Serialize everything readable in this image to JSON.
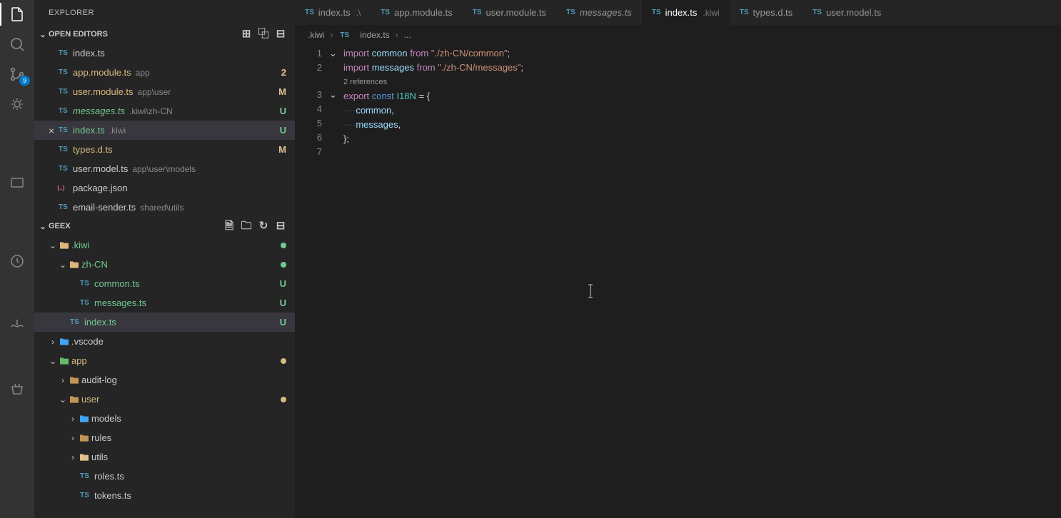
{
  "sidebar": {
    "title": "EXPLORER",
    "openEditors": {
      "label": "OPEN EDITORS",
      "items": [
        {
          "file": "index.ts",
          "hint": "",
          "status": "",
          "close": false,
          "italic": false
        },
        {
          "file": "app.module.ts",
          "hint": "app",
          "status": "2",
          "close": false,
          "italic": false,
          "color": "yellow"
        },
        {
          "file": "user.module.ts",
          "hint": "app\\user",
          "status": "M",
          "close": false,
          "italic": false,
          "color": "yellow"
        },
        {
          "file": "messages.ts",
          "hint": ".kiwi\\zh-CN",
          "status": "U",
          "close": false,
          "italic": true,
          "color": "green"
        },
        {
          "file": "index.ts",
          "hint": ".kiwi",
          "status": "U",
          "close": true,
          "italic": false,
          "color": "green",
          "selected": true
        },
        {
          "file": "types.d.ts",
          "hint": "",
          "status": "M",
          "close": false,
          "italic": false,
          "color": "yellow"
        },
        {
          "file": "user.model.ts",
          "hint": "app\\user\\models",
          "status": "",
          "close": false,
          "italic": false
        },
        {
          "file": "package.json",
          "hint": "",
          "status": "",
          "close": false,
          "italic": false,
          "iconType": "json"
        },
        {
          "file": "email-sender.ts",
          "hint": "shared\\utils",
          "status": "",
          "close": false,
          "italic": false
        }
      ]
    },
    "project": {
      "label": "GEEX",
      "tree": [
        {
          "depth": 0,
          "chev": "down",
          "icon": "folder-open",
          "name": ".kiwi",
          "dot": "green",
          "color": "green"
        },
        {
          "depth": 1,
          "chev": "down",
          "icon": "folder-open",
          "name": "zh-CN",
          "dot": "green",
          "color": "green"
        },
        {
          "depth": 2,
          "chev": "",
          "icon": "ts",
          "name": "common.ts",
          "status": "U",
          "color": "green"
        },
        {
          "depth": 2,
          "chev": "",
          "icon": "ts",
          "name": "messages.ts",
          "status": "U",
          "color": "green"
        },
        {
          "depth": 1,
          "chev": "",
          "icon": "ts",
          "name": "index.ts",
          "status": "U",
          "color": "green",
          "selected": true
        },
        {
          "depth": 0,
          "chev": "right",
          "icon": "folder-special",
          "name": ".vscode"
        },
        {
          "depth": 0,
          "chev": "down",
          "icon": "folder-app",
          "name": "app",
          "dot": "yellow",
          "color": "yellow"
        },
        {
          "depth": 1,
          "chev": "right",
          "icon": "folder",
          "name": "audit-log"
        },
        {
          "depth": 1,
          "chev": "down",
          "icon": "folder",
          "name": "user",
          "dot": "yellow",
          "color": "yellow"
        },
        {
          "depth": 2,
          "chev": "right",
          "icon": "folder-models",
          "name": "models"
        },
        {
          "depth": 2,
          "chev": "right",
          "icon": "folder",
          "name": "rules"
        },
        {
          "depth": 2,
          "chev": "right",
          "icon": "folder-utils",
          "name": "utils"
        },
        {
          "depth": 2,
          "chev": "",
          "icon": "ts",
          "name": "roles.ts"
        },
        {
          "depth": 2,
          "chev": "",
          "icon": "ts",
          "name": "tokens.ts"
        }
      ]
    }
  },
  "activityBadge": "9",
  "tabs": [
    {
      "label": "index.ts",
      "hint": ".\\",
      "active": false
    },
    {
      "label": "app.module.ts",
      "hint": "",
      "active": false
    },
    {
      "label": "user.module.ts",
      "hint": "",
      "active": false
    },
    {
      "label": "messages.ts",
      "hint": "",
      "active": false,
      "italic": true
    },
    {
      "label": "index.ts",
      "hint": ".kiwi",
      "active": true
    },
    {
      "label": "types.d.ts",
      "hint": "",
      "active": false
    },
    {
      "label": "user.model.ts",
      "hint": "",
      "active": false
    }
  ],
  "breadcrumb": {
    "p1": ".kiwi",
    "p2": "index.ts",
    "p3": "..."
  },
  "code": {
    "codelens": "2 references",
    "lines": [
      "1",
      "2",
      "3",
      "4",
      "5",
      "6",
      "7"
    ],
    "l1": {
      "kw": "import",
      "v": "common",
      "kw2": "from",
      "s": "\"./zh-CN/common\""
    },
    "l2": {
      "kw": "import",
      "v": "messages",
      "kw2": "from",
      "s": "\"./zh-CN/messages\""
    },
    "l3": {
      "kw": "export",
      "kw2": "const",
      "t": "I18N",
      "eq": "=",
      "b": "{"
    },
    "l4": {
      "v": "common",
      "c": ","
    },
    "l5": {
      "v": "messages",
      "c": ","
    },
    "l6": {
      "b": "};"
    }
  }
}
